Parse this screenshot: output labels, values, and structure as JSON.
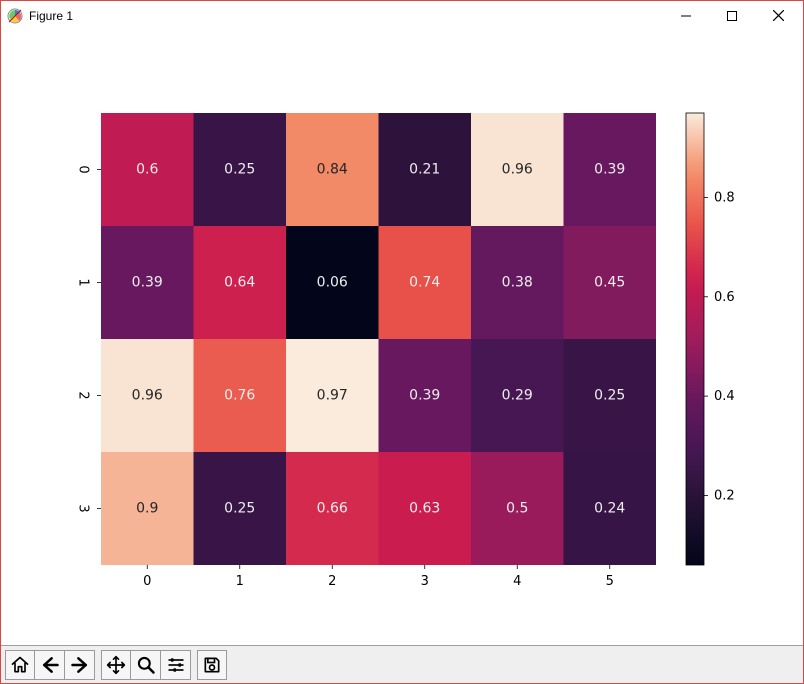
{
  "window": {
    "title": "Figure 1"
  },
  "toolbar": {
    "home": "Home",
    "back": "Back",
    "forward": "Forward",
    "pan": "Pan",
    "zoom": "Zoom",
    "subplots": "Configure subplots",
    "save": "Save"
  },
  "chart_data": {
    "type": "heatmap",
    "annotated": true,
    "cmap": "rocket",
    "row_labels": [
      "0",
      "1",
      "2",
      "3"
    ],
    "col_labels": [
      "0",
      "1",
      "2",
      "3",
      "4",
      "5"
    ],
    "values": [
      [
        0.6,
        0.25,
        0.84,
        0.21,
        0.96,
        0.39
      ],
      [
        0.39,
        0.64,
        0.06,
        0.74,
        0.38,
        0.45
      ],
      [
        0.96,
        0.76,
        0.97,
        0.39,
        0.29,
        0.25
      ],
      [
        0.9,
        0.25,
        0.66,
        0.63,
        0.5,
        0.24
      ]
    ],
    "colorbar": {
      "ticks": [
        0.2,
        0.4,
        0.6,
        0.8
      ]
    }
  }
}
